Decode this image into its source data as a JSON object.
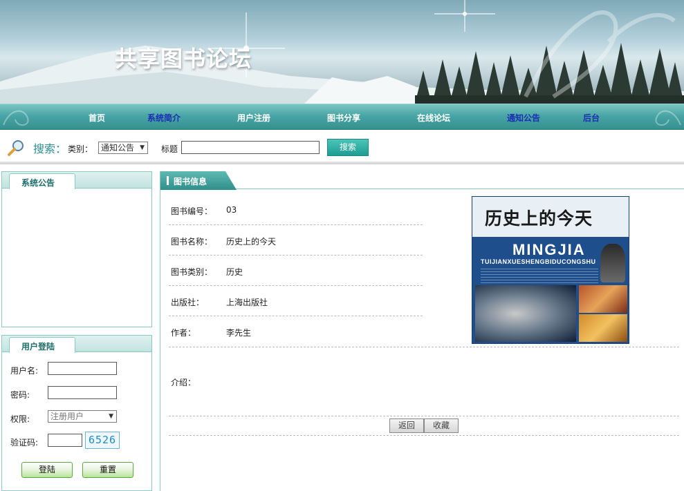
{
  "site": {
    "title": "共享图书论坛"
  },
  "nav": {
    "items": [
      {
        "label": "首页",
        "highlight": false
      },
      {
        "label": "系统简介",
        "highlight": true
      },
      {
        "label": "用户注册",
        "highlight": false
      },
      {
        "label": "图书分享",
        "highlight": false
      },
      {
        "label": "在线论坛",
        "highlight": false
      },
      {
        "label": "通知公告",
        "highlight": true
      },
      {
        "label": "后台",
        "highlight": true
      }
    ]
  },
  "search": {
    "title": "搜索：",
    "category_label": "类别：",
    "category_value": "通知公告",
    "title_label": "标题",
    "title_value": "",
    "button": "搜索"
  },
  "announcement": {
    "heading": "系统公告"
  },
  "login": {
    "heading": "用户登陆",
    "username_label": "用户名:",
    "username_value": "",
    "password_label": "密码:",
    "password_value": "",
    "role_label": "权限:",
    "role_value": "注册用户",
    "captcha_label": "验证码:",
    "captcha_value": "",
    "captcha_code": "6526",
    "login_button": "登陆",
    "reset_button": "重置"
  },
  "book": {
    "heading": "图书信息",
    "fields": [
      {
        "label": "图书编号：",
        "value": "03"
      },
      {
        "label": "图书名称：",
        "value": "历史上的今天"
      },
      {
        "label": "图书类别：",
        "value": "历史"
      },
      {
        "label": "出版社：",
        "value": "上海出版社"
      },
      {
        "label": "作者：",
        "value": "李先生"
      }
    ],
    "intro_label": "介绍：",
    "cover": {
      "title": "历史上的今天",
      "pinyin_line1": "MINGJIA",
      "pinyin_line2": "TUIJIANXUESHENGBIDUCONGSHU"
    },
    "back_button": "返回",
    "favorite_button": "收藏"
  },
  "colors": {
    "accent": "#3a9e9c",
    "nav_highlight": "#1a2fb5",
    "panel_border": "#8cc8c4"
  }
}
